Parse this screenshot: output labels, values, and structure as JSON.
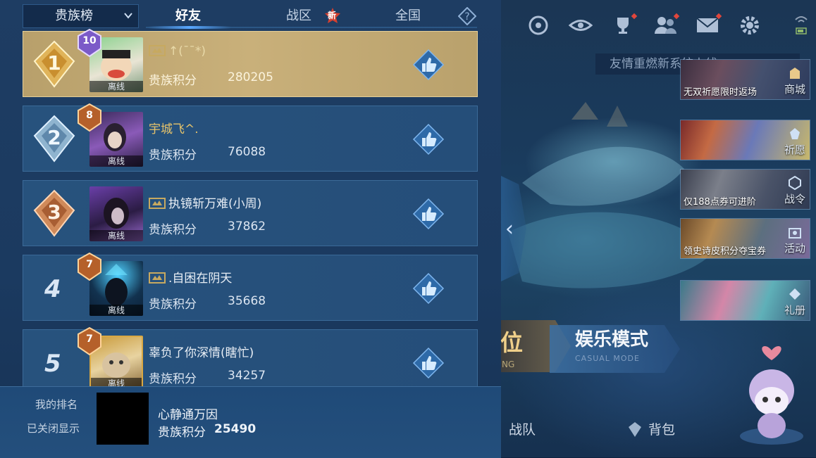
{
  "panel": {
    "dropdown_label": "贵族榜",
    "tabs": [
      {
        "label": "好友",
        "active": true
      },
      {
        "label": "战区",
        "badge": "新"
      },
      {
        "label": "全国"
      }
    ],
    "help_icon": "question-icon",
    "score_label": "贵族积分",
    "rows": [
      {
        "rank": "1",
        "level": "10",
        "name": "↑(¯¯*)",
        "status": "离线",
        "score": "280205",
        "has_noble_icon": true
      },
      {
        "rank": "2",
        "level": "8",
        "name": "宇城飞^.",
        "status": "离线",
        "score": "76088",
        "has_noble_icon": false
      },
      {
        "rank": "3",
        "level": "",
        "name": "执镜斩万难(小周)",
        "status": "离线",
        "score": "37862",
        "has_noble_icon": true
      },
      {
        "rank": "4",
        "level": "7",
        "name": ".自困在阴天",
        "status": "离线",
        "score": "35668",
        "has_noble_icon": true
      },
      {
        "rank": "5",
        "level": "7",
        "name": "辜负了你深情(瞎忙)",
        "status": "离线",
        "score": "34257",
        "has_noble_icon": false
      }
    ],
    "my_rank": {
      "label": "我的排名",
      "hidden_text": "已关闭显示",
      "name": "心静通万因",
      "score_label": "贵族积分",
      "score": "25490"
    }
  },
  "game": {
    "notice": "友情重燃新系统上线",
    "promos": [
      {
        "caption": "无双祈愿限时返场",
        "side": "商城"
      },
      {
        "caption": "",
        "side": "祈愿"
      },
      {
        "caption": "仅188点券可进阶",
        "side": "战令"
      },
      {
        "caption": "领史诗皮积分夺宝券",
        "side": "活动"
      },
      {
        "caption": "",
        "side": "礼册"
      }
    ],
    "mode_rank": "位",
    "mode_rank_sub": "NG",
    "mode_casual": "娱乐模式",
    "mode_casual_sub": "CASUAL MODE",
    "nav": {
      "team": "战队",
      "bag": "背包"
    }
  },
  "colors": {
    "panel_bg": "#1e3d63",
    "first_row_gold": "#c9b07a",
    "accent_blue": "#59a8ff",
    "new_badge_red": "#d6402f"
  }
}
